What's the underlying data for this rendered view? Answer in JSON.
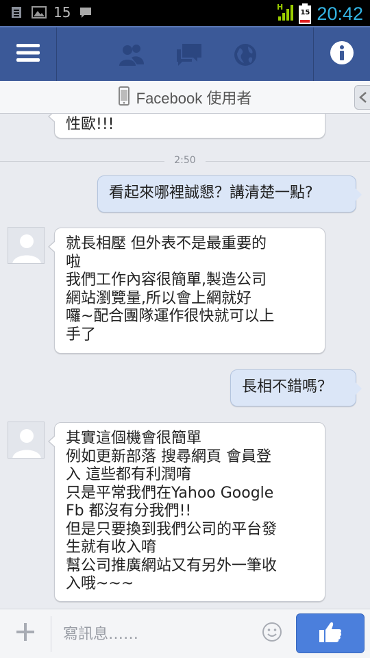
{
  "status_bar": {
    "notification_count": "15",
    "battery_level": "15",
    "time": "20:42"
  },
  "top_bar": {
    "icons": [
      "menu-icon",
      "friends-icon",
      "messages-icon",
      "globe-icon",
      "info-icon"
    ]
  },
  "conversation": {
    "title": "Facebook 使用者"
  },
  "messages": [
    {
      "type": "received",
      "text": "性歐!!!"
    },
    {
      "type": "timestamp",
      "text": "2:50"
    },
    {
      "type": "sent",
      "text": "看起來哪裡誠懇？講清楚一點?"
    },
    {
      "type": "received",
      "text": "就長相壓 但外表不是最重要的\n啦\n我們工作內容很簡單,製造公司\n網站瀏覽量,所以會上網就好\n囉~配合團隊運作很快就可以上\n手了"
    },
    {
      "type": "sent",
      "text": "長相不錯嗎？"
    },
    {
      "type": "received",
      "text": "其實這個機會很簡單\n例如更新部落 搜尋網頁 會員登\n入 這些都有利潤唷\n只是平常我們在Yahoo Google\nFb 都沒有分我們!!\n但是只要換到我們公司的平台發\n生就有收入唷\n幫公司推廣網站又有另外一筆收\n入哦~~~"
    }
  ],
  "composer": {
    "placeholder": "寫訊息……",
    "value": ""
  },
  "colors": {
    "facebook_blue": "#3b5998",
    "like_button": "#4b7fdc",
    "clock": "#33b5e5",
    "signal": "#99cc00"
  }
}
